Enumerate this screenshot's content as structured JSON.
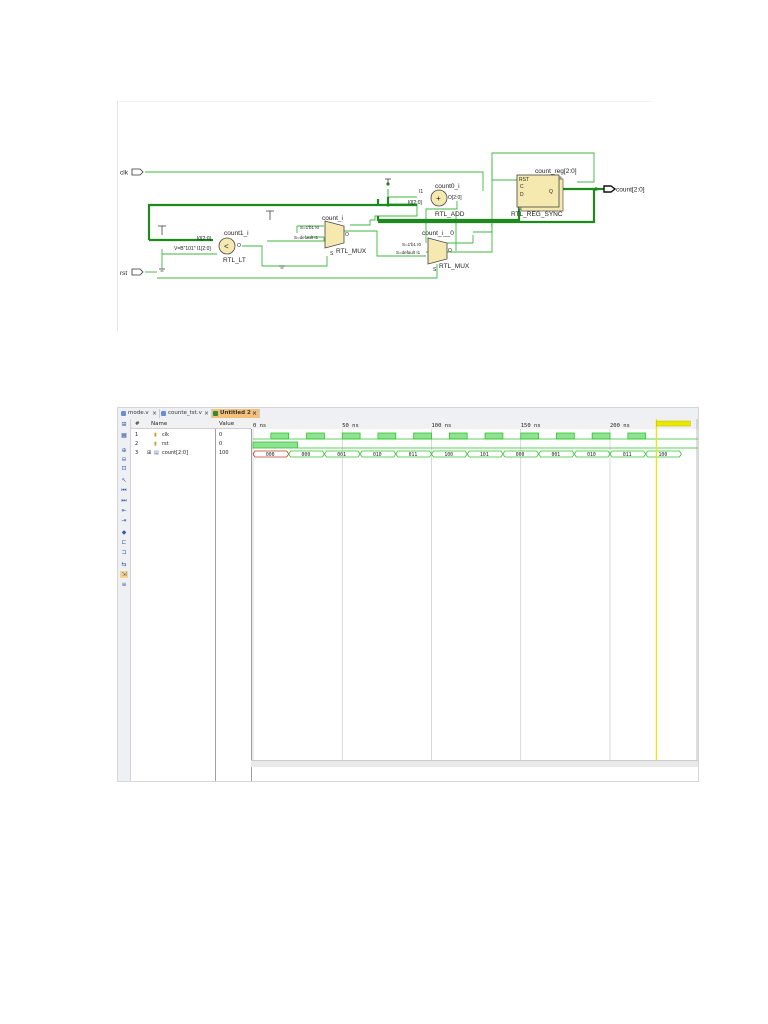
{
  "schematic": {
    "ports": {
      "clk": "clk",
      "rst": "rst",
      "count_out": "count[2:0]"
    },
    "cells": {
      "adder": {
        "inst": "count0_i",
        "type": "RTL_ADD",
        "pin_i1": "I1",
        "pin_i0": "I0[2:0]",
        "pin_o": "O[2:0]",
        "symbol": "+"
      },
      "register": {
        "inst": "count_reg[2:0]",
        "type": "RTL_REG_SYNC",
        "pin_rst": "RST",
        "pin_c": "C",
        "pin_d": "D",
        "pin_q": "Q"
      },
      "compare": {
        "inst": "count1_i",
        "type": "RTL_LT",
        "pin_i0": "I0[2:0]",
        "pin_i1": "V=B\"101\" I1[2:0]",
        "pin_o": "O",
        "symbol": "<"
      },
      "mux1": {
        "inst": "count_i",
        "type": "RTL_MUX",
        "pin_i0": "S=1'b1 I0",
        "pin_i1": "S=default I1",
        "pin_o": "O",
        "pin_s": "S"
      },
      "mux2": {
        "inst": "count_i__0",
        "type": "RTL_MUX",
        "pin_i0": "S=1'b1 I0",
        "pin_i1": "S=default I1",
        "pin_o": "O",
        "pin_s": "S"
      }
    }
  },
  "waveform": {
    "tabs": [
      {
        "label": "mode.v",
        "close": "×"
      },
      {
        "label": "counte_tst.v",
        "close": "×"
      },
      {
        "label": "Untitled 2",
        "close": "×"
      }
    ],
    "headers": {
      "num": "#",
      "name": "Name",
      "value": "Value"
    },
    "signals": [
      {
        "num": "1",
        "name": "clk",
        "value": "0"
      },
      {
        "num": "2",
        "name": "rst",
        "value": "0"
      },
      {
        "num": "3",
        "name": "count[2:0]",
        "value": "100"
      }
    ],
    "time_labels": [
      "0 ns",
      "50 ns",
      "100 ns",
      "150 ns",
      "200 ns"
    ],
    "bus_values": [
      "000",
      "000",
      "001",
      "010",
      "011",
      "100",
      "101",
      "000",
      "001",
      "010",
      "011",
      "100"
    ],
    "cursor_time_ns": 226,
    "clock_period_ns": 20,
    "clock_edges_count": 11,
    "reset_high_until_ns": 25,
    "colors": {
      "wave": "#2ec52e",
      "cursor": "#e8e800",
      "schematic_wire": "#3fb63f",
      "bus_wire": "#1e8a1e",
      "cell_fill": "#f6e9b0"
    }
  }
}
